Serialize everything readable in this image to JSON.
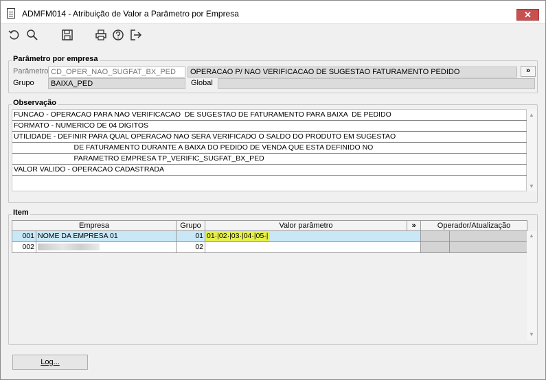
{
  "window": {
    "title": "ADMFM014 - Atribuição de Valor a Parâmetro por Empresa",
    "close_label": "✕"
  },
  "toolbar": {
    "icons": [
      "undo-icon",
      "search-icon",
      "save-icon",
      "print-icon",
      "help-icon",
      "exit-icon"
    ]
  },
  "parametro": {
    "legend": "Parâmetro por empresa",
    "parametro_label": "Parâmetro",
    "parametro_code": "CD_OPER_NAO_SUGFAT_BX_PED",
    "parametro_desc": "OPERACAO P/ NAO VERIFICACAO  DE SUGESTAO FATURAMENTO PEDIDO",
    "expand_label": "»",
    "grupo_label": "Grupo",
    "grupo_value": "BAIXA_PED",
    "global_label": "Global",
    "global_value": ""
  },
  "observacao": {
    "legend": "Observação",
    "lines": [
      "FUNCAO - OPERACAO PARA NAO VERIFICACAO  DE SUGESTAO DE FATURAMENTO PARA BAIXA  DE PEDIDO",
      "FORMATO - NUMERICO DE 04 DIGITOS",
      "UTILIDADE - DEFINIR PARA QUAL OPERACAO NAO SERA VERIFICADO O SALDO DO PRODUTO EM SUGESTAO",
      "                              DE FATURAMENTO DURANTE A BAIXA DO PEDIDO DE VENDA QUE ESTA DEFINIDO NO",
      "                              PARAMETRO EMPRESA TP_VERIFIC_SUGFAT_BX_PED",
      "VALOR VALIDO - OPERACAO CADASTRADA"
    ]
  },
  "item": {
    "legend": "Item",
    "columns": {
      "empresa": "Empresa",
      "grupo": "Grupo",
      "valor": "Valor parâmetro",
      "expand": "»",
      "operador": "Operador/Atualização"
    },
    "rows": [
      {
        "code": "001",
        "name": "NOME DA EMPRESA 01",
        "grupo": "01",
        "valor": "01·|02·|03·|04·|05·|"
      },
      {
        "code": "002",
        "name": "",
        "grupo": "02",
        "valor": ""
      }
    ]
  },
  "footer": {
    "log_label": "Log..."
  },
  "colors": {
    "selected_row": "#c8e8f8",
    "highlight": "#e6f04a",
    "close": "#c75050"
  }
}
